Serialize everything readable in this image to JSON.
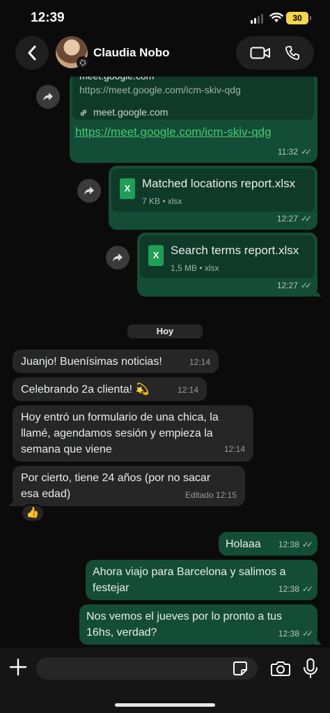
{
  "status_bar": {
    "time": "12:39",
    "battery": "30"
  },
  "header": {
    "contact_name": "Claudia Nobo"
  },
  "link_message": {
    "preview_title": "meet.google.com",
    "preview_url": "https://meet.google.com/icm-skiv-qdg",
    "preview_domain": "meet.google.com",
    "link": "https://meet.google.com/icm-skiv-qdg",
    "time": "11:32"
  },
  "files": [
    {
      "name": "Matched locations report.xlsx",
      "info": "7 KB • xlsx",
      "time": "12:27",
      "icon": "X"
    },
    {
      "name": "Search terms report.xlsx",
      "info": "1,5 MB • xlsx",
      "time": "12:27",
      "icon": "X"
    }
  ],
  "day_label": "Hoy",
  "incoming": [
    {
      "text": "Juanjo! Buenísimas noticias!",
      "time": "12:14"
    },
    {
      "text": "Celebrando 2a clienta! 💫",
      "time": "12:14"
    },
    {
      "line1": "Hoy entró un formulario de una chica, la",
      "line2": "llamé, agendamos sesión y empieza la",
      "line3": "semana que viene",
      "time": "12:14"
    },
    {
      "line1": "Por cierto, tiene 24 años (por no sacar",
      "line2": "esa edad)",
      "time": "Editado 12:15",
      "reaction": "👍"
    }
  ],
  "outgoing": [
    {
      "text": "Holaaa",
      "time": "12:38"
    },
    {
      "line1": "Ahora viajo para Barcelona y salimos a",
      "line2": "festejar",
      "time": "12:38"
    },
    {
      "line1": "Nos vemos el jueves por lo pronto a tus",
      "line2": "16hs, verdad?",
      "time": "12:38"
    }
  ],
  "input": {
    "value": "",
    "placeholder": ""
  },
  "icons": {
    "back": "chevron-left-icon",
    "video": "video-camera-icon",
    "phone": "phone-icon",
    "forward": "forward-arrow-icon",
    "plus": "plus-icon",
    "sticker": "sticker-icon",
    "camera": "camera-icon",
    "mic": "microphone-icon"
  },
  "colors": {
    "outgoing": "#144d37",
    "incoming": "#262626",
    "link": "#46c872",
    "background": "#0b0b0b"
  }
}
